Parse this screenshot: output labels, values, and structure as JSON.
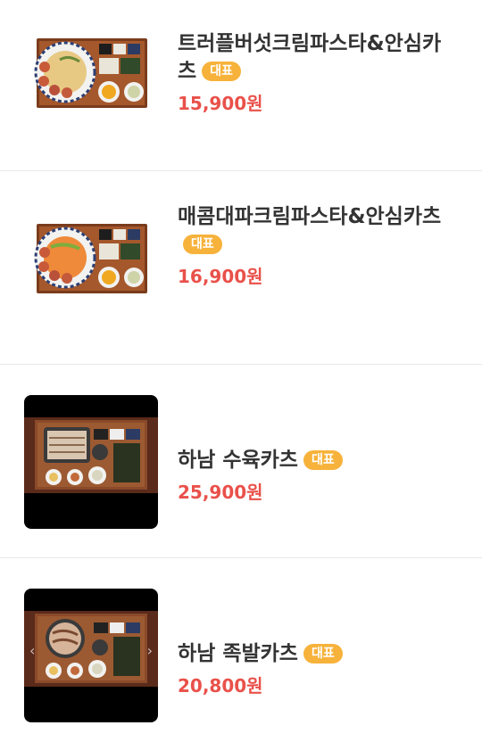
{
  "menu": [
    {
      "name": "트러플버섯크림파스타&안심카츠",
      "badge": "대표",
      "price": "15,900원",
      "image_icon": "food-tray-pasta-image"
    },
    {
      "name": "매콤대파크림파스타&안심카츠",
      "badge": "대표",
      "price": "16,900원",
      "image_icon": "food-tray-pasta-image"
    },
    {
      "name": "하남 수육카츠",
      "badge": "대표",
      "price": "25,900원",
      "image_icon": "food-tray-pork-image"
    },
    {
      "name": "하남 족발카츠",
      "badge": "대표",
      "price": "20,800원",
      "image_icon": "food-tray-pork-image"
    }
  ],
  "carousel": {
    "prev_icon": "‹",
    "next_icon": "›"
  },
  "colors": {
    "badge_bg": "#f7b23b",
    "price": "#e9514a",
    "divider": "#e9e9e9"
  }
}
